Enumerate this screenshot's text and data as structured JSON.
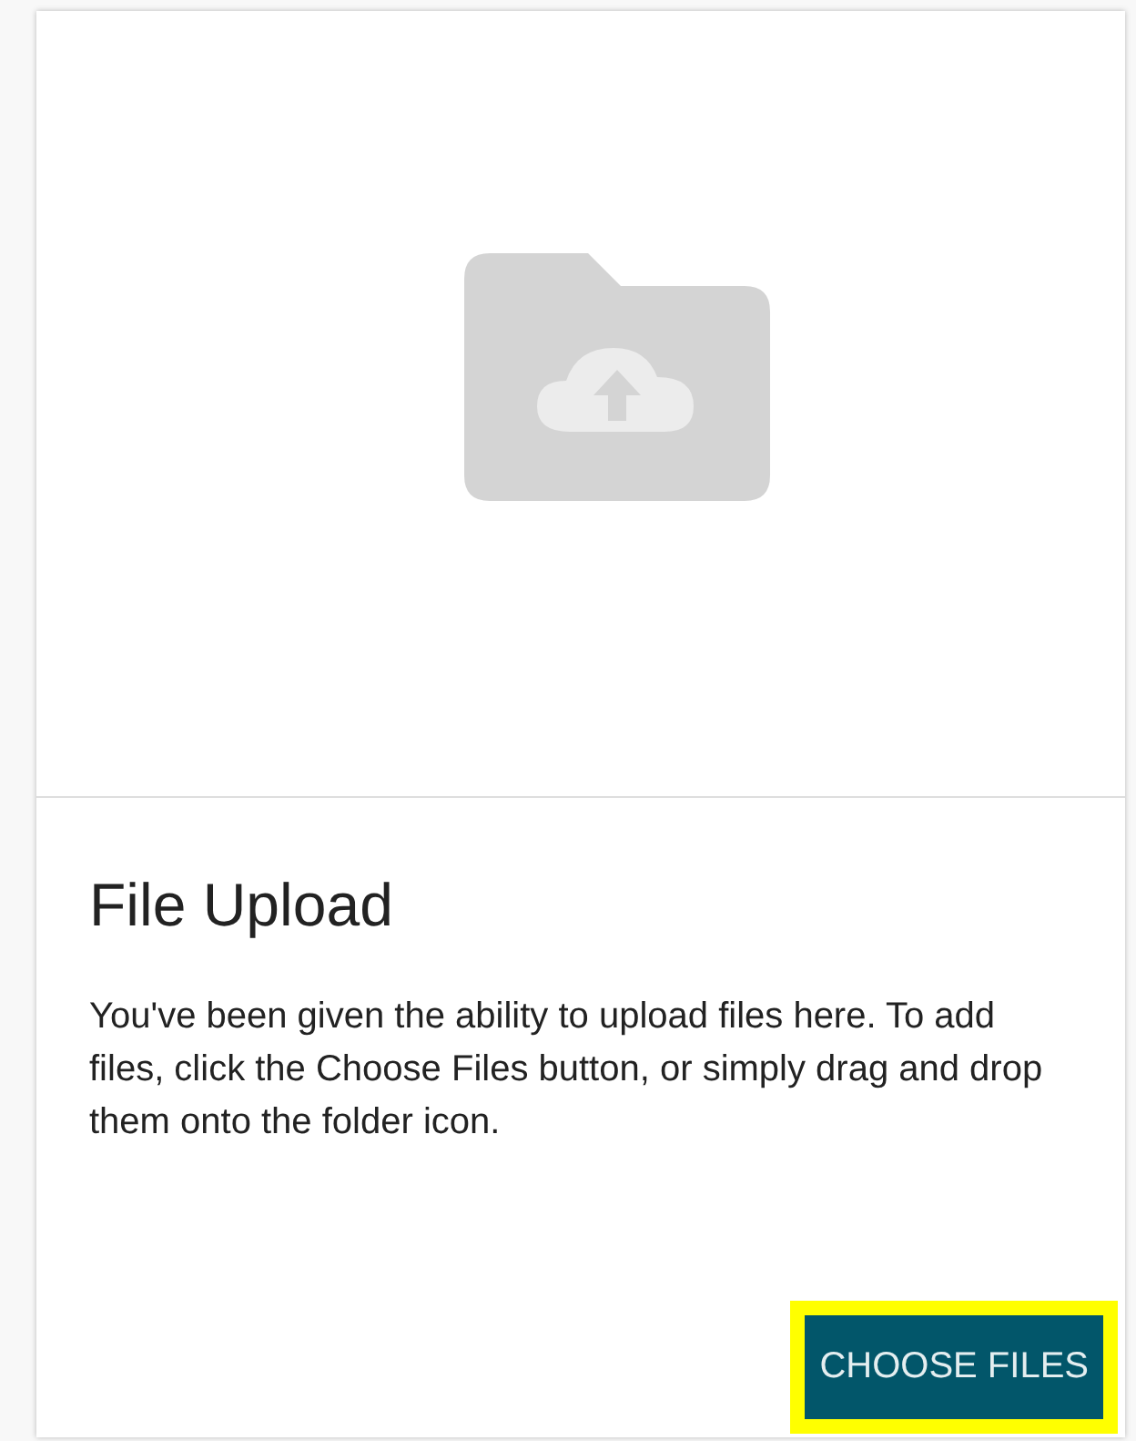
{
  "card": {
    "title": "File Upload",
    "description": "You've been given the ability to upload files here. To add files, click the Choose Files button, or simply drag and drop them onto the folder icon.",
    "button": {
      "label": "CHOOSE FILES",
      "focused": true
    }
  }
}
